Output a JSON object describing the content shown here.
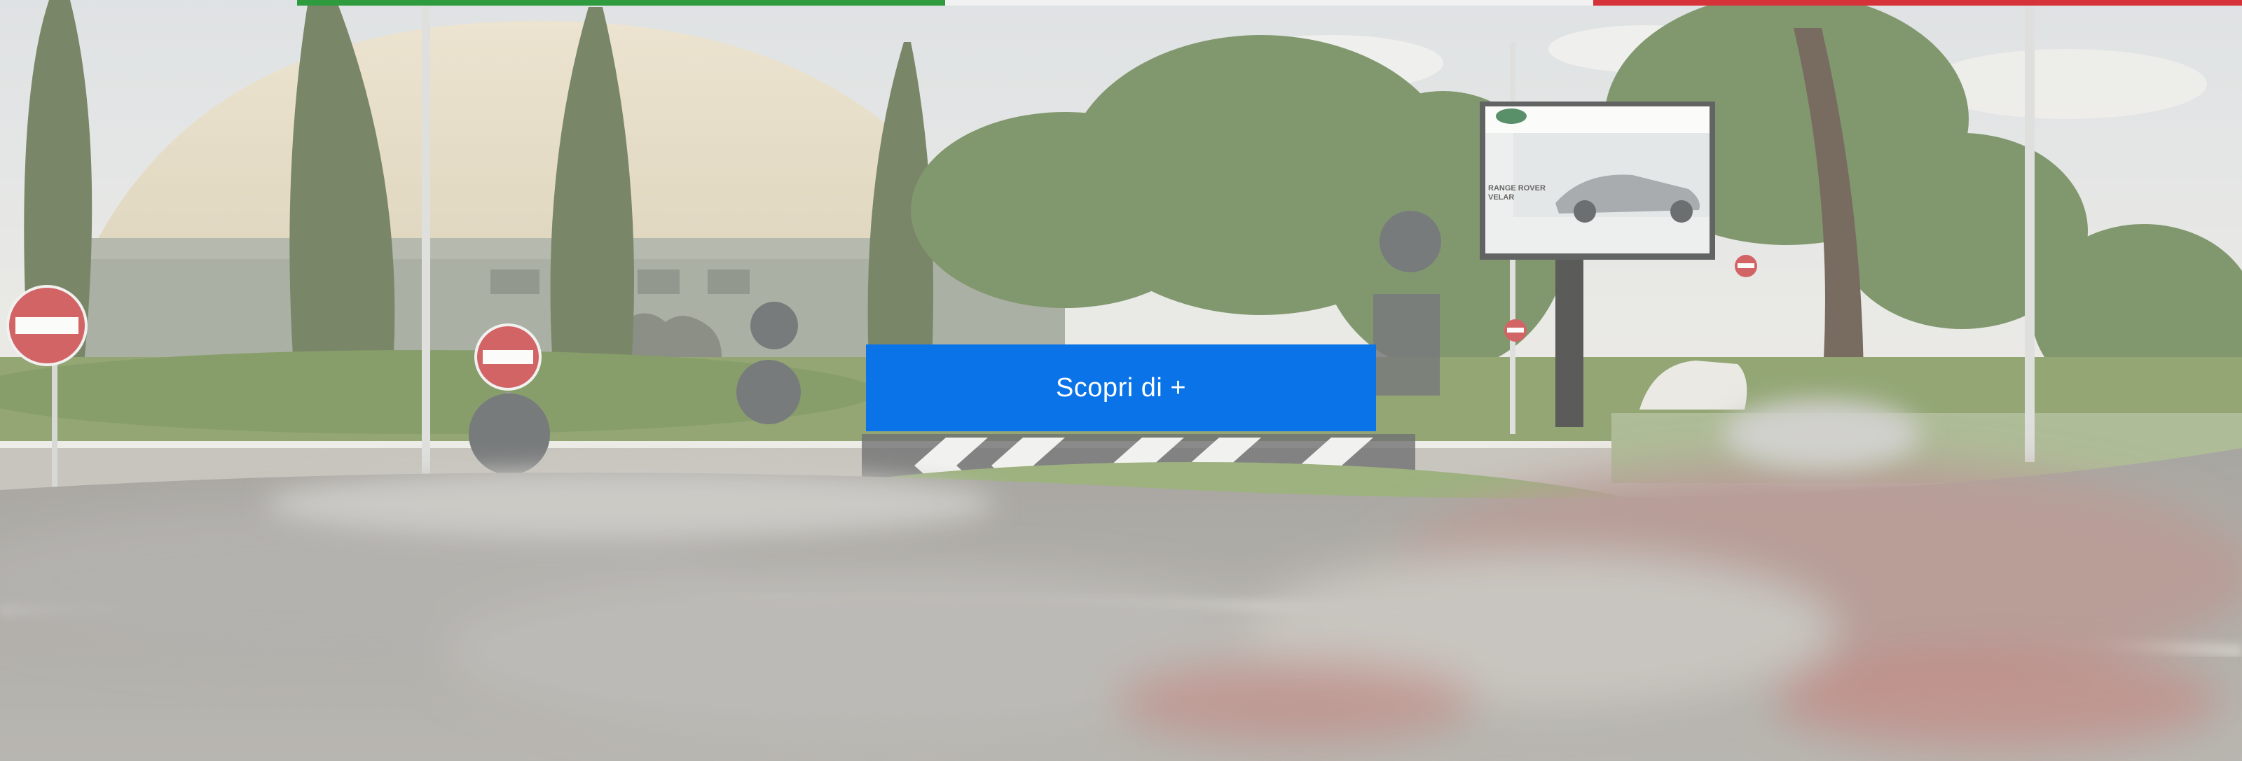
{
  "hero": {
    "cta_label": "Scopri di +",
    "billboard": {
      "model_line1": "RANGE ROVER",
      "model_line2": "VELAR"
    }
  },
  "colors": {
    "cta_background": "#0a73e8",
    "cta_text": "#ffffff",
    "flag_green": "#2e9b3e",
    "flag_white": "#f1f1f1",
    "flag_red": "#d6323a",
    "overlay": "#f2efea"
  },
  "icons": {
    "no_entry_sign": "no-entry-sign-icon",
    "chevron_sign": "chevron-left-sign-icon",
    "brand_logo": "land-rover-logo-icon"
  }
}
